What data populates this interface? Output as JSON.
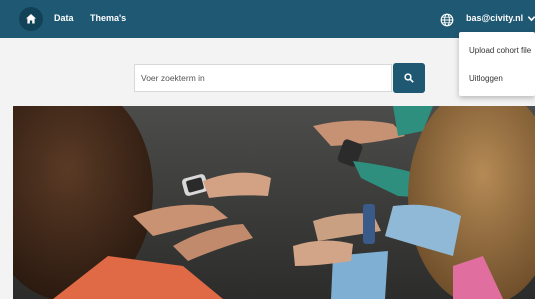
{
  "nav": {
    "links": [
      {
        "label": "Data"
      },
      {
        "label": "Thema's"
      }
    ],
    "home_icon": "home-icon",
    "globe_icon": "globe-icon",
    "user": {
      "email": "bas@civity.nl",
      "chevron_icon": "chevron-down-icon"
    },
    "dropdown": [
      {
        "label": "Upload cohort file"
      },
      {
        "label": "Uitloggen"
      }
    ]
  },
  "search": {
    "placeholder": "Voer zoekterm in",
    "value": "",
    "button_icon": "search-icon"
  },
  "hero": {
    "image_subject": "people-checking-smartwatches"
  },
  "colors": {
    "navbar": "#1f5873",
    "home_button": "#124257",
    "search_button": "#1f5873",
    "page_background": "#f3f3f3"
  }
}
